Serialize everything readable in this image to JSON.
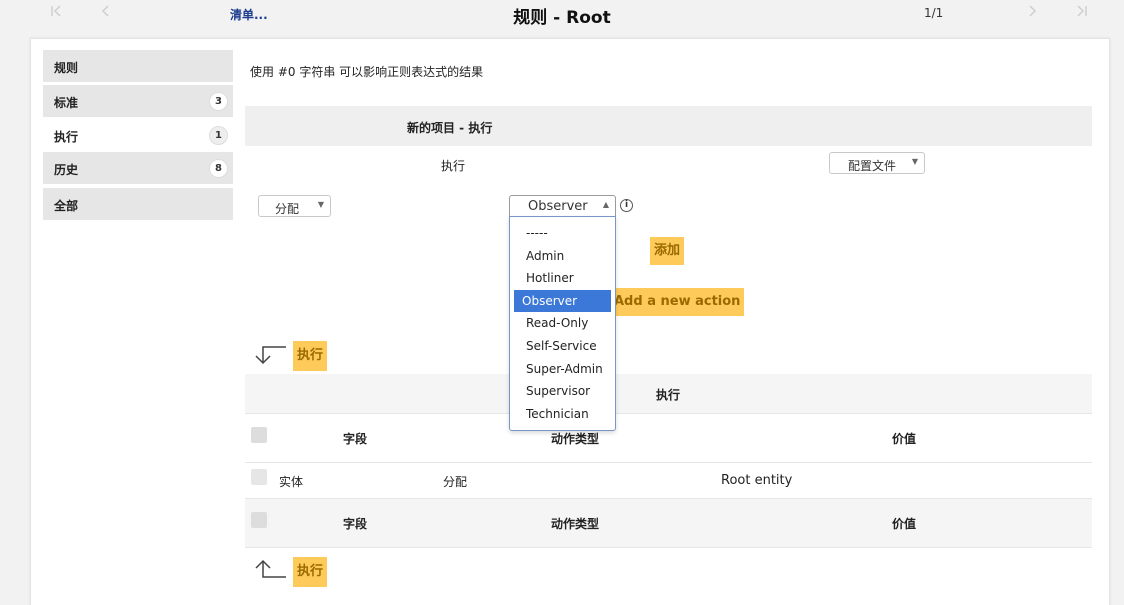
{
  "topbar": {
    "list_link": "清单...",
    "title": "规则 - Root",
    "page_count": "1/1",
    "first_icon": "⟨|",
    "prev_icon": "‹",
    "next_icon": "›",
    "last_icon": "|⟩"
  },
  "sidebar": {
    "items": [
      {
        "label": "规则",
        "badge": ""
      },
      {
        "label": "标准",
        "badge": "3"
      },
      {
        "label": "执行",
        "badge": "1"
      },
      {
        "label": "历史",
        "badge": "8"
      },
      {
        "label": "全部",
        "badge": ""
      }
    ]
  },
  "main": {
    "hint": "使用 #0 字符串 可以影响正则表达式的结果",
    "new_item_title": "新的项目 - 执行",
    "action_label": "执行",
    "profile_select": "配置文件",
    "assign_select": "分配",
    "value_select": "Observer",
    "info_icon": "i",
    "add_button": "添加",
    "add_new_action_button": "Add a new action",
    "dropdown_options": [
      "-----",
      "Admin",
      "Hotliner",
      "Observer",
      "Read-Only",
      "Self-Service",
      "Super-Admin",
      "Supervisor",
      "Technician"
    ],
    "dropdown_selected": "Observer",
    "batch_action_button": "执行",
    "batch_action_button_bottom": "执行"
  },
  "table": {
    "caption": "执行",
    "headers": {
      "field": "字段",
      "action_type": "动作类型",
      "value": "价值"
    },
    "rows": [
      {
        "field": "实体",
        "action_type": "分配",
        "value": "Root entity"
      }
    ]
  },
  "colors": {
    "accent_yellow": "#fecb5a",
    "selected_blue": "#3c78d8",
    "link_blue": "#1d3d8f"
  }
}
